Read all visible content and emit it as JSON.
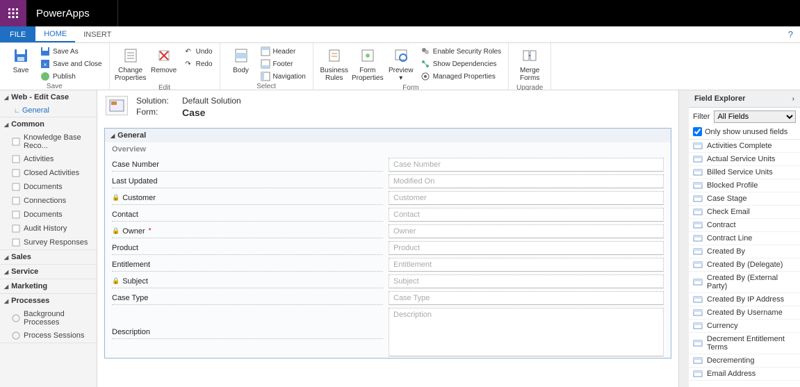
{
  "brand": "PowerApps",
  "tabs": {
    "file": "FILE",
    "home": "HOME",
    "insert": "INSERT"
  },
  "ribbon": {
    "save": {
      "save": "Save",
      "saveAs": "Save As",
      "saveClose": "Save and Close",
      "publish": "Publish",
      "group": "Save"
    },
    "edit": {
      "changeProps": "Change\nProperties",
      "remove": "Remove",
      "undo": "Undo",
      "redo": "Redo",
      "group": "Edit"
    },
    "select": {
      "body": "Body",
      "header": "Header",
      "footer": "Footer",
      "nav": "Navigation",
      "group": "Select"
    },
    "form": {
      "bizRules": "Business\nRules",
      "formProps": "Form\nProperties",
      "preview": "Preview",
      "enableSec": "Enable Security Roles",
      "showDeps": "Show Dependencies",
      "managedProps": "Managed Properties",
      "group": "Form"
    },
    "upgrade": {
      "merge": "Merge\nForms",
      "group": "Upgrade"
    }
  },
  "leftnav": {
    "web": {
      "title": "Web - Edit Case",
      "general": "General"
    },
    "common": {
      "title": "Common",
      "items": [
        "Knowledge Base Reco...",
        "Activities",
        "Closed Activities",
        "Documents",
        "Connections",
        "Documents",
        "Audit History",
        "Survey Responses"
      ]
    },
    "sales": {
      "title": "Sales"
    },
    "service": {
      "title": "Service"
    },
    "marketing": {
      "title": "Marketing"
    },
    "processes": {
      "title": "Processes",
      "items": [
        "Background Processes",
        "Process Sessions"
      ]
    }
  },
  "canvas": {
    "solutionLabel": "Solution:",
    "solutionValue": "Default Solution",
    "formLabel": "Form:",
    "formName": "Case",
    "section": "General",
    "overview": "Overview",
    "fields": [
      {
        "label": "Case Number",
        "placeholder": "Case Number",
        "locked": false,
        "required": false
      },
      {
        "label": "Last Updated",
        "placeholder": "Modified On",
        "locked": false,
        "required": false
      },
      {
        "label": "Customer",
        "placeholder": "Customer",
        "locked": true,
        "required": false
      },
      {
        "label": "Contact",
        "placeholder": "Contact",
        "locked": false,
        "required": false
      },
      {
        "label": "Owner",
        "placeholder": "Owner",
        "locked": true,
        "required": true
      },
      {
        "label": "Product",
        "placeholder": "Product",
        "locked": false,
        "required": false
      },
      {
        "label": "Entitlement",
        "placeholder": "Entitlement",
        "locked": false,
        "required": false
      },
      {
        "label": "Subject",
        "placeholder": "Subject",
        "locked": true,
        "required": false
      },
      {
        "label": "Case Type",
        "placeholder": "Case Type",
        "locked": false,
        "required": false
      },
      {
        "label": "Description",
        "placeholder": "Description",
        "locked": false,
        "required": false,
        "tall": true
      }
    ]
  },
  "explorer": {
    "title": "Field Explorer",
    "filterLabel": "Filter",
    "filterValue": "All Fields",
    "unusedLabel": "Only show unused fields",
    "unusedChecked": true,
    "items": [
      "Activities Complete",
      "Actual Service Units",
      "Billed Service Units",
      "Blocked Profile",
      "Case Stage",
      "Check Email",
      "Contract",
      "Contract Line",
      "Created By",
      "Created By (Delegate)",
      "Created By (External Party)",
      "Created By IP Address",
      "Created By Username",
      "Currency",
      "Decrement Entitlement Terms",
      "Decrementing",
      "Email Address"
    ]
  }
}
